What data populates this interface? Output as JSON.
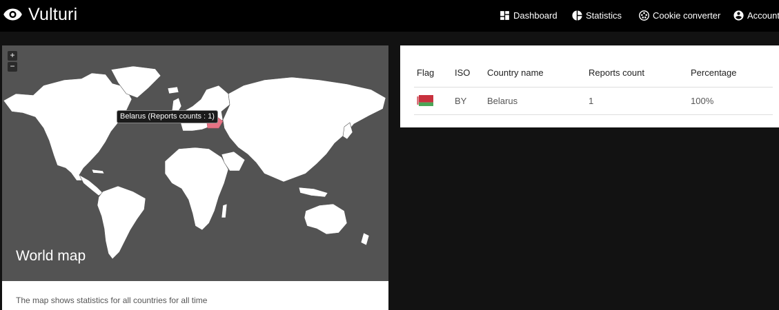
{
  "app": {
    "title": "Vulturi"
  },
  "nav": [
    {
      "label": "Dashboard",
      "icon": "dashboard-icon"
    },
    {
      "label": "Statistics",
      "icon": "pie-chart-icon"
    },
    {
      "label": "Cookie converter",
      "icon": "cookie-icon"
    },
    {
      "label": "Account",
      "icon": "account-circle-icon"
    }
  ],
  "map": {
    "zoom_in": "+",
    "zoom_out": "−",
    "tooltip": "Belarus (Reports counts : 1)",
    "title": "World map",
    "description": "The map shows statistics for all countries for all time",
    "highlight_color": "#e57384"
  },
  "table": {
    "headers": [
      "Flag",
      "ISO",
      "Country name",
      "Reports count",
      "Percentage"
    ],
    "rows": [
      {
        "flag": "belarus-flag",
        "iso": "BY",
        "country": "Belarus",
        "reports": "1",
        "percentage": "100%"
      }
    ]
  },
  "colors": {
    "topbar": "#000000",
    "background": "#121212",
    "map_bg": "#535353",
    "land": "#ffffff",
    "flag_red": "#c8313e",
    "flag_green": "#4aa657"
  }
}
